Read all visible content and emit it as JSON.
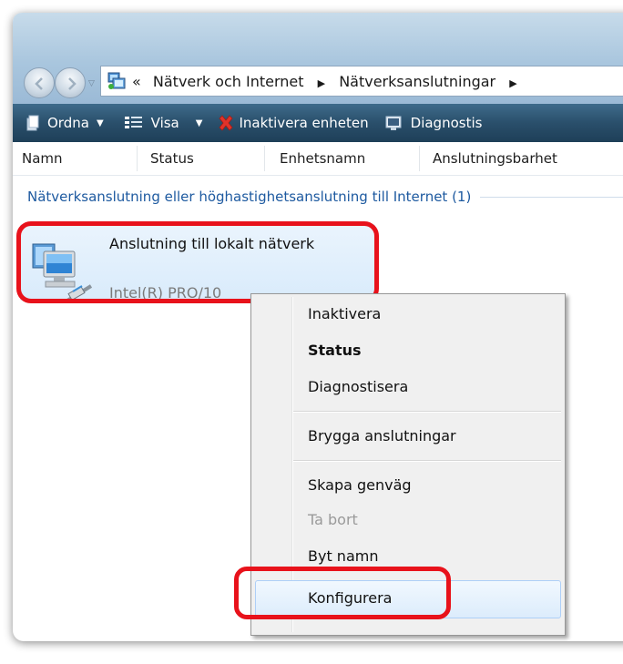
{
  "address": {
    "overflow_label": "«",
    "crumbs": [
      "Nätverk och Internet",
      "Nätverksanslutningar"
    ],
    "separator": "▶"
  },
  "toolbar": {
    "organize_label": "Ordna",
    "view_label": "Visa",
    "disable_label": "Inaktivera enheten",
    "diagnose_label": "Diagnostis"
  },
  "columns": {
    "name": "Namn",
    "status": "Status",
    "device": "Enhetsnamn",
    "connectivity": "Anslutningsbarhet"
  },
  "group": {
    "title": "Nätverksanslutning eller höghastighetsanslutning till Internet (1)"
  },
  "connection": {
    "name": "Anslutning till lokalt nätverk",
    "device": "Intel(R) PRO/10"
  },
  "context_menu": {
    "items": [
      {
        "label": "Inaktivera"
      },
      {
        "label": "Status"
      },
      {
        "label": "Diagnostisera"
      },
      {
        "label": "Brygga anslutningar"
      },
      {
        "label": "Skapa genväg"
      },
      {
        "label": "Ta bort"
      },
      {
        "label": "Byt namn"
      },
      {
        "label": "Konfigurera"
      }
    ]
  },
  "colors": {
    "highlight": "#e8121b",
    "toolbar": "#2a4f6b",
    "group_text": "#1e5aa0"
  }
}
